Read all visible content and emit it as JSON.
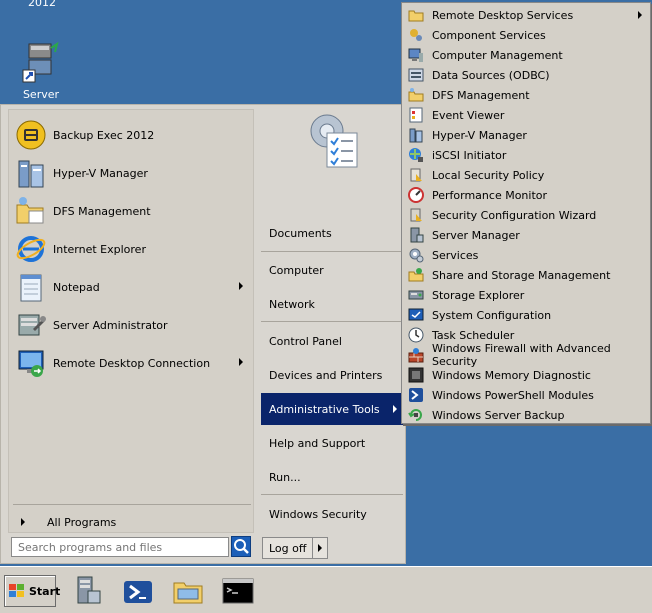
{
  "desktop": {
    "caption": "2012",
    "icon_label": "Server"
  },
  "pinned": [
    {
      "label": "Backup Exec 2012",
      "icon": "backup-exec-icon",
      "has_submenu": false
    },
    {
      "label": "Hyper-V Manager",
      "icon": "hyperv-manager-icon",
      "has_submenu": false
    },
    {
      "label": "DFS Management",
      "icon": "dfs-management-icon",
      "has_submenu": false
    },
    {
      "label": "Internet Explorer",
      "icon": "internet-explorer-icon",
      "has_submenu": false
    },
    {
      "label": "Notepad",
      "icon": "notepad-icon",
      "has_submenu": true
    },
    {
      "label": "Server Administrator",
      "icon": "server-administrator-icon",
      "has_submenu": false
    },
    {
      "label": "Remote Desktop Connection",
      "icon": "remote-desktop-icon",
      "has_submenu": true
    }
  ],
  "all_programs": "All Programs",
  "search": {
    "placeholder": "Search programs and files"
  },
  "right": {
    "documents": "Documents",
    "computer": "Computer",
    "network": "Network",
    "control_panel": "Control Panel",
    "devices_printers": "Devices and Printers",
    "admin_tools": "Administrative Tools",
    "help_support": "Help and Support",
    "run": "Run...",
    "windows_security": "Windows Security"
  },
  "logoff": "Log off",
  "admin_submenu": [
    {
      "label": "Remote Desktop Services",
      "icon": "folder-icon",
      "has_submenu": true
    },
    {
      "label": "Component Services",
      "icon": "component-services-icon",
      "has_submenu": false
    },
    {
      "label": "Computer Management",
      "icon": "computer-management-icon",
      "has_submenu": false
    },
    {
      "label": "Data Sources (ODBC)",
      "icon": "odbc-icon",
      "has_submenu": false
    },
    {
      "label": "DFS Management",
      "icon": "dfs-icon",
      "has_submenu": false
    },
    {
      "label": "Event Viewer",
      "icon": "event-viewer-icon",
      "has_submenu": false
    },
    {
      "label": "Hyper-V Manager",
      "icon": "hyperv-icon",
      "has_submenu": false
    },
    {
      "label": "iSCSI Initiator",
      "icon": "iscsi-icon",
      "has_submenu": false
    },
    {
      "label": "Local Security Policy",
      "icon": "security-policy-icon",
      "has_submenu": false
    },
    {
      "label": "Performance Monitor",
      "icon": "performance-monitor-icon",
      "has_submenu": false
    },
    {
      "label": "Security Configuration Wizard",
      "icon": "security-wizard-icon",
      "has_submenu": false
    },
    {
      "label": "Server Manager",
      "icon": "server-manager-icon",
      "has_submenu": false
    },
    {
      "label": "Services",
      "icon": "services-icon",
      "has_submenu": false
    },
    {
      "label": "Share and Storage Management",
      "icon": "share-storage-icon",
      "has_submenu": false
    },
    {
      "label": "Storage Explorer",
      "icon": "storage-explorer-icon",
      "has_submenu": false
    },
    {
      "label": "System Configuration",
      "icon": "system-configuration-icon",
      "has_submenu": false
    },
    {
      "label": "Task Scheduler",
      "icon": "task-scheduler-icon",
      "has_submenu": false
    },
    {
      "label": "Windows Firewall with Advanced Security",
      "icon": "firewall-icon",
      "has_submenu": false
    },
    {
      "label": "Windows Memory Diagnostic",
      "icon": "memory-diagnostic-icon",
      "has_submenu": false
    },
    {
      "label": "Windows PowerShell Modules",
      "icon": "powershell-modules-icon",
      "has_submenu": false
    },
    {
      "label": "Windows Server Backup",
      "icon": "server-backup-icon",
      "has_submenu": false
    }
  ],
  "taskbar": {
    "start_label": "Start",
    "pinned_icons": [
      "server-manager-icon",
      "powershell-icon",
      "explorer-folder-icon",
      "command-prompt-icon"
    ]
  },
  "colors": {
    "desktop": "#3a6ea5",
    "menu_bg": "#d4d0c8",
    "highlight": "#0a246a"
  }
}
